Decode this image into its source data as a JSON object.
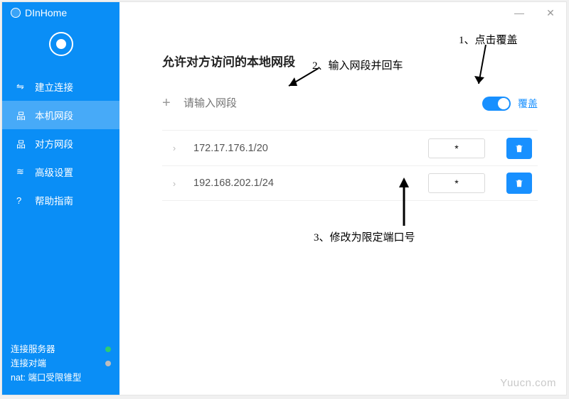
{
  "app_title": "DInHome",
  "sidebar": {
    "items": [
      {
        "icon": "⇋",
        "label": "建立连接"
      },
      {
        "icon": "品",
        "label": "本机网段"
      },
      {
        "icon": "品",
        "label": "对方网段"
      },
      {
        "icon": "≋",
        "label": "高级设置"
      },
      {
        "icon": "?",
        "label": "帮助指南"
      }
    ],
    "status_server": "连接服务器",
    "status_peer": "连接对端",
    "nat_label": "nat: 端口受限锥型"
  },
  "main": {
    "title": "允许对方访问的本地网段",
    "input_placeholder": "请输入网段",
    "toggle_label": "覆盖",
    "rows": [
      {
        "cidr": "172.17.176.1/20",
        "port": "*"
      },
      {
        "cidr": "192.168.202.1/24",
        "port": "*"
      }
    ]
  },
  "annotations": {
    "a1": "1、点击覆盖",
    "a2": "2、输入网段并回车",
    "a3": "3、修改为限定端口号"
  },
  "watermark": "Yuucn.com"
}
